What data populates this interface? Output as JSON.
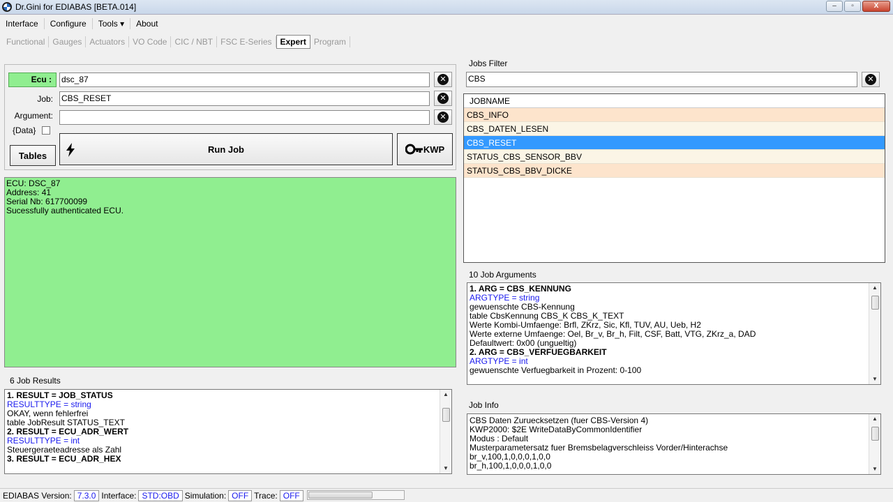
{
  "window": {
    "title": "Dr.Gini for EDIABAS [BETA.014]",
    "controls": [
      "–",
      "▫",
      "X"
    ]
  },
  "menu": [
    "Interface",
    "Configure",
    "Tools ▾",
    "About"
  ],
  "tabs": [
    {
      "label": "Functional",
      "active": false
    },
    {
      "label": "Gauges",
      "active": false
    },
    {
      "label": "Actuators",
      "active": false
    },
    {
      "label": "VO Code",
      "active": false
    },
    {
      "label": "CIC / NBT",
      "active": false
    },
    {
      "label": "FSC E-Series",
      "active": false
    },
    {
      "label": "Expert",
      "active": true
    },
    {
      "label": "Program",
      "active": false
    }
  ],
  "ecu_panel": {
    "ecu_label": "Ecu :",
    "ecu_value": "dsc_87",
    "job_label": "Job:",
    "job_value": "CBS_RESET",
    "argument_label": "Argument:",
    "argument_value": "",
    "data_label": "{Data}",
    "tables_button": "Tables",
    "run_job_button": "Run Job",
    "kwp_button": "KWP",
    "clear_glyph": "✕"
  },
  "console": {
    "lines": [
      "ECU: DSC_87",
      "Address: 41",
      "Serial Nb: 617700099",
      "Sucessfully authenticated ECU."
    ]
  },
  "job_results": {
    "title": "6 Job Results",
    "lines": [
      {
        "text": "1. RESULT = JOB_STATUS",
        "style": "bold"
      },
      {
        "text": "RESULTTYPE = string",
        "style": "blue"
      },
      {
        "text": "OKAY, wenn fehlerfrei",
        "style": "normal"
      },
      {
        "text": "table JobResult STATUS_TEXT",
        "style": "normal"
      },
      {
        "text": "2. RESULT = ECU_ADR_WERT",
        "style": "bold"
      },
      {
        "text": "RESULTTYPE = int",
        "style": "blue"
      },
      {
        "text": "Steuergeraeteadresse als Zahl",
        "style": "normal"
      },
      {
        "text": "3. RESULT = ECU_ADR_HEX",
        "style": "bold"
      }
    ]
  },
  "jobs_filter": {
    "title": "Jobs Filter",
    "filter_value": "CBS",
    "column_header": "JOBNAME",
    "rows": [
      "CBS_INFO",
      "CBS_DATEN_LESEN",
      "CBS_RESET",
      "STATUS_CBS_SENSOR_BBV",
      "STATUS_CBS_BBV_DICKE"
    ],
    "selected_index": 2
  },
  "job_arguments": {
    "title": "10 Job Arguments",
    "lines": [
      {
        "text": "1. ARG = CBS_KENNUNG",
        "style": "bold"
      },
      {
        "text": "ARGTYPE = string",
        "style": "blue"
      },
      {
        "text": "gewuenschte CBS-Kennung",
        "style": "normal"
      },
      {
        "text": "table CbsKennung CBS_K CBS_K_TEXT",
        "style": "normal"
      },
      {
        "text": "Werte Kombi-Umfaenge: Brfl, ZKrz, Sic, Kfl, TUV, AU, Ueb, H2",
        "style": "normal"
      },
      {
        "text": "Werte externe Umfaenge: Oel, Br_v, Br_h, Filt, CSF, Batt, VTG, ZKrz_a, DAD",
        "style": "normal"
      },
      {
        "text": "Defaultwert: 0x00 (ungueltig)",
        "style": "normal"
      },
      {
        "text": "2. ARG = CBS_VERFUEGBARKEIT",
        "style": "bold"
      },
      {
        "text": "ARGTYPE = int",
        "style": "blue"
      },
      {
        "text": "gewuenschte Verfuegbarkeit in Prozent: 0-100",
        "style": "normal"
      }
    ]
  },
  "job_info": {
    "title": "Job Info",
    "lines": [
      "CBS Daten Zuruecksetzen (fuer CBS-Version 4)",
      "KWP2000: $2E WriteDataByCommonIdentifier",
      "Modus  : Default",
      "Musterparametersatz fuer Bremsbelagverschleiss Vorder/Hinterachse",
      "br_v,100,1,0,0,0,1,0,0",
      "br_h,100,1,0,0,0,1,0,0"
    ]
  },
  "status": {
    "ediabas_label": "EDIABAS Version:",
    "ediabas_value": "7.3.0",
    "interface_label": "Interface:",
    "interface_value": "STD:OBD",
    "simulation_label": "Simulation:",
    "simulation_value": "OFF",
    "trace_label": "Trace:",
    "trace_value": "OFF"
  }
}
